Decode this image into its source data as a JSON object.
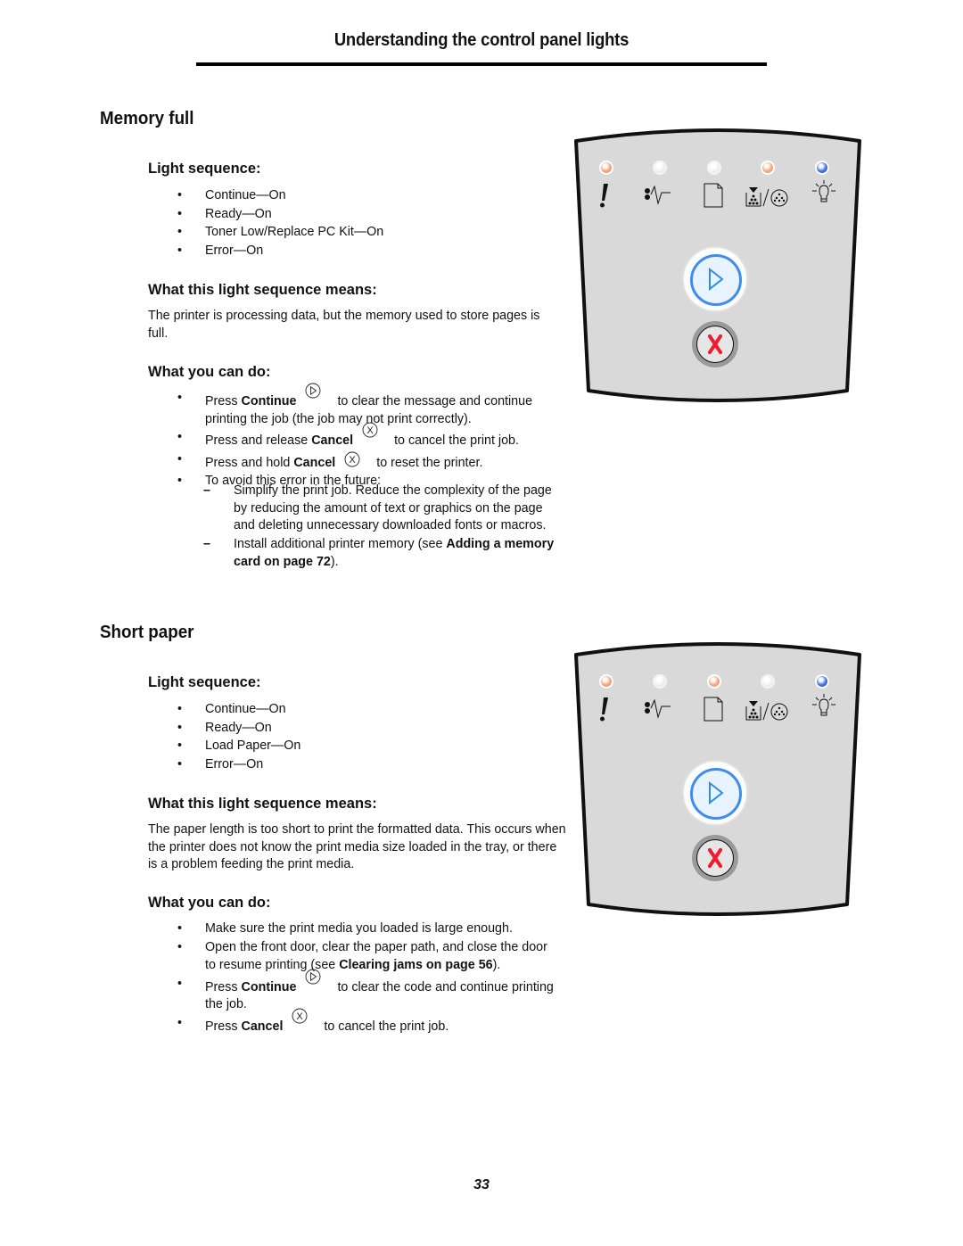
{
  "header": {
    "title": "Understanding the control panel lights"
  },
  "sections": [
    {
      "title": "Memory full",
      "light_sequence_heading": "Light sequence:",
      "light_sequence": [
        "Continue—On",
        "Ready—On",
        "Toner Low/Replace PC Kit—On",
        "Error—On"
      ],
      "means_heading": "What this light sequence means:",
      "means_text": "The printer is processing data, but the memory used to store pages is full.",
      "actions_heading": "What you can do:",
      "actions": [
        {
          "pre": "Press ",
          "bold": "Continue",
          "icon": "continue-icon",
          "post": " to clear the message and continue printing the job (the job may not print correctly)."
        },
        {
          "pre": "Press and release ",
          "bold": "Cancel",
          "icon": "cancel-icon",
          "post": " to cancel the print job."
        },
        {
          "pre": "Press and hold ",
          "bold": "Cancel",
          "icon": "cancel-icon",
          "post": " to reset the printer."
        },
        {
          "pre": "To avoid this error in the future:"
        }
      ],
      "sub_actions": [
        {
          "text": "Simplify the print job. Reduce the complexity of the page by reducing the amount of text or graphics on the page and deleting unnecessary downloaded fonts or macros."
        },
        {
          "pre": "Install additional printer memory (see ",
          "bold": "Adding a memory card on page 72",
          "post": ")."
        }
      ],
      "panel": {
        "lights": [
          {
            "name": "error",
            "state": "on",
            "color": "#f4a27a"
          },
          {
            "name": "paper-jam",
            "state": "off",
            "color": "#f2f2f2"
          },
          {
            "name": "load-paper",
            "state": "off",
            "color": "#f2f2f2"
          },
          {
            "name": "toner-low-pc-kit",
            "state": "on",
            "color": "#f4a27a"
          },
          {
            "name": "ready",
            "state": "on",
            "color": "#3a6fe0"
          }
        ],
        "continue_state": "on",
        "cancel_state": "available"
      }
    },
    {
      "title": "Short paper",
      "light_sequence_heading": "Light sequence:",
      "light_sequence": [
        "Continue—On",
        "Ready—On",
        "Load Paper—On",
        "Error—On"
      ],
      "means_heading": "What this light sequence means:",
      "means_text": "The paper length is too short to print the formatted data. This occurs when the printer does not know the print media size loaded in the tray, or there is a problem feeding the print media.",
      "actions_heading": "What you can do:",
      "actions": [
        {
          "pre": "Make sure the print media you loaded is large enough."
        },
        {
          "pre": "Open the front door, clear the paper path, and close the door to resume printing (see ",
          "bold": "Clearing jams on page 56",
          "post": ")."
        },
        {
          "pre": "Press ",
          "bold": "Continue",
          "icon": "continue-icon",
          "post": " to clear the code and continue printing the job."
        },
        {
          "pre": "Press ",
          "bold": "Cancel",
          "icon": "cancel-icon",
          "post": " to cancel the print job."
        }
      ],
      "panel": {
        "lights": [
          {
            "name": "error",
            "state": "on",
            "color": "#f4a27a"
          },
          {
            "name": "paper-jam",
            "state": "off",
            "color": "#f2f2f2"
          },
          {
            "name": "load-paper",
            "state": "on",
            "color": "#f4a27a"
          },
          {
            "name": "toner-low-pc-kit",
            "state": "off",
            "color": "#f2f2f2"
          },
          {
            "name": "ready",
            "state": "on",
            "color": "#3a6fe0"
          }
        ],
        "continue_state": "on",
        "cancel_state": "available"
      }
    }
  ],
  "footer": {
    "page_number": "33"
  },
  "colors": {
    "panel_bg": "#d9d9d9",
    "continue_blue": "#3d8cf0",
    "cancel_red": "#ee1c2e",
    "error_amber": "#f4a27a",
    "ready_blue": "#3a6fe0"
  }
}
